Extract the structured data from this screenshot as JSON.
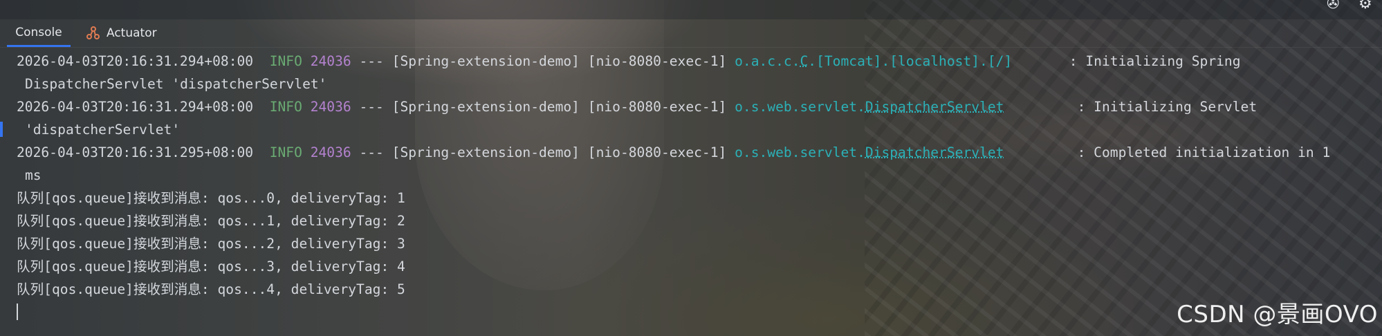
{
  "toolbar": {
    "icons": [
      "globe-icon",
      "gear-icon"
    ]
  },
  "tabs": [
    {
      "label": "Console",
      "active": true
    },
    {
      "label": "Actuator",
      "active": false,
      "icon": "actuator-icon"
    }
  ],
  "colors": {
    "active_tab_underline": "#3574f0",
    "log_level_info": "#6aab73",
    "process_id": "#b482cf",
    "logger_name": "#2bb1b7",
    "text": "#d4d7dc"
  },
  "log": [
    {
      "timestamp": "2026-04-03T20:16:31.294+08:00",
      "level": "INFO",
      "pid": "24036",
      "separator": "---",
      "app": "[Spring-extension-demo]",
      "thread": "[nio-8080-exec-1]",
      "logger_prefix": "o.a.c.c.",
      "logger_class": "C",
      "logger_suffix": ".[Tomcat].[localhost].[/]",
      "message": ": Initializing Spring",
      "continuation": "DispatcherServlet 'dispatcherServlet'"
    },
    {
      "timestamp": "2026-04-03T20:16:31.294+08:00",
      "level": "INFO",
      "pid": "24036",
      "separator": "---",
      "app": "[Spring-extension-demo]",
      "thread": "[nio-8080-exec-1]",
      "logger_prefix": "o.s.web.servlet.",
      "logger_class": "DispatcherServlet",
      "logger_suffix": "",
      "message": ": Initializing Servlet",
      "continuation": "'dispatcherServlet'"
    },
    {
      "timestamp": "2026-04-03T20:16:31.295+08:00",
      "level": "INFO",
      "pid": "24036",
      "separator": "---",
      "app": "[Spring-extension-demo]",
      "thread": "[nio-8080-exec-1]",
      "logger_prefix": "o.s.web.servlet.",
      "logger_class": "DispatcherServlet",
      "logger_suffix": "",
      "message": ": Completed initialization in 1",
      "continuation": "ms"
    }
  ],
  "output": [
    "队列[qos.queue]接收到消息: qos...0, deliveryTag: 1",
    "队列[qos.queue]接收到消息: qos...1, deliveryTag: 2",
    "队列[qos.queue]接收到消息: qos...2, deliveryTag: 3",
    "队列[qos.queue]接收到消息: qos...3, deliveryTag: 4",
    "队列[qos.queue]接收到消息: qos...4, deliveryTag: 5"
  ],
  "watermark": "CSDN @景画OVO"
}
